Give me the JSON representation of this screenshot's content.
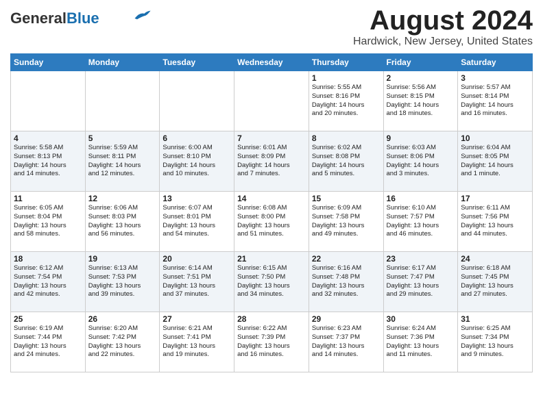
{
  "header": {
    "logo_general": "General",
    "logo_blue": "Blue",
    "month_title": "August 2024",
    "location": "Hardwick, New Jersey, United States"
  },
  "weekdays": [
    "Sunday",
    "Monday",
    "Tuesday",
    "Wednesday",
    "Thursday",
    "Friday",
    "Saturday"
  ],
  "weeks": [
    [
      {
        "day": "",
        "content": ""
      },
      {
        "day": "",
        "content": ""
      },
      {
        "day": "",
        "content": ""
      },
      {
        "day": "",
        "content": ""
      },
      {
        "day": "1",
        "content": "Sunrise: 5:55 AM\nSunset: 8:16 PM\nDaylight: 14 hours\nand 20 minutes."
      },
      {
        "day": "2",
        "content": "Sunrise: 5:56 AM\nSunset: 8:15 PM\nDaylight: 14 hours\nand 18 minutes."
      },
      {
        "day": "3",
        "content": "Sunrise: 5:57 AM\nSunset: 8:14 PM\nDaylight: 14 hours\nand 16 minutes."
      }
    ],
    [
      {
        "day": "4",
        "content": "Sunrise: 5:58 AM\nSunset: 8:13 PM\nDaylight: 14 hours\nand 14 minutes."
      },
      {
        "day": "5",
        "content": "Sunrise: 5:59 AM\nSunset: 8:11 PM\nDaylight: 14 hours\nand 12 minutes."
      },
      {
        "day": "6",
        "content": "Sunrise: 6:00 AM\nSunset: 8:10 PM\nDaylight: 14 hours\nand 10 minutes."
      },
      {
        "day": "7",
        "content": "Sunrise: 6:01 AM\nSunset: 8:09 PM\nDaylight: 14 hours\nand 7 minutes."
      },
      {
        "day": "8",
        "content": "Sunrise: 6:02 AM\nSunset: 8:08 PM\nDaylight: 14 hours\nand 5 minutes."
      },
      {
        "day": "9",
        "content": "Sunrise: 6:03 AM\nSunset: 8:06 PM\nDaylight: 14 hours\nand 3 minutes."
      },
      {
        "day": "10",
        "content": "Sunrise: 6:04 AM\nSunset: 8:05 PM\nDaylight: 14 hours\nand 1 minute."
      }
    ],
    [
      {
        "day": "11",
        "content": "Sunrise: 6:05 AM\nSunset: 8:04 PM\nDaylight: 13 hours\nand 58 minutes."
      },
      {
        "day": "12",
        "content": "Sunrise: 6:06 AM\nSunset: 8:03 PM\nDaylight: 13 hours\nand 56 minutes."
      },
      {
        "day": "13",
        "content": "Sunrise: 6:07 AM\nSunset: 8:01 PM\nDaylight: 13 hours\nand 54 minutes."
      },
      {
        "day": "14",
        "content": "Sunrise: 6:08 AM\nSunset: 8:00 PM\nDaylight: 13 hours\nand 51 minutes."
      },
      {
        "day": "15",
        "content": "Sunrise: 6:09 AM\nSunset: 7:58 PM\nDaylight: 13 hours\nand 49 minutes."
      },
      {
        "day": "16",
        "content": "Sunrise: 6:10 AM\nSunset: 7:57 PM\nDaylight: 13 hours\nand 46 minutes."
      },
      {
        "day": "17",
        "content": "Sunrise: 6:11 AM\nSunset: 7:56 PM\nDaylight: 13 hours\nand 44 minutes."
      }
    ],
    [
      {
        "day": "18",
        "content": "Sunrise: 6:12 AM\nSunset: 7:54 PM\nDaylight: 13 hours\nand 42 minutes."
      },
      {
        "day": "19",
        "content": "Sunrise: 6:13 AM\nSunset: 7:53 PM\nDaylight: 13 hours\nand 39 minutes."
      },
      {
        "day": "20",
        "content": "Sunrise: 6:14 AM\nSunset: 7:51 PM\nDaylight: 13 hours\nand 37 minutes."
      },
      {
        "day": "21",
        "content": "Sunrise: 6:15 AM\nSunset: 7:50 PM\nDaylight: 13 hours\nand 34 minutes."
      },
      {
        "day": "22",
        "content": "Sunrise: 6:16 AM\nSunset: 7:48 PM\nDaylight: 13 hours\nand 32 minutes."
      },
      {
        "day": "23",
        "content": "Sunrise: 6:17 AM\nSunset: 7:47 PM\nDaylight: 13 hours\nand 29 minutes."
      },
      {
        "day": "24",
        "content": "Sunrise: 6:18 AM\nSunset: 7:45 PM\nDaylight: 13 hours\nand 27 minutes."
      }
    ],
    [
      {
        "day": "25",
        "content": "Sunrise: 6:19 AM\nSunset: 7:44 PM\nDaylight: 13 hours\nand 24 minutes."
      },
      {
        "day": "26",
        "content": "Sunrise: 6:20 AM\nSunset: 7:42 PM\nDaylight: 13 hours\nand 22 minutes."
      },
      {
        "day": "27",
        "content": "Sunrise: 6:21 AM\nSunset: 7:41 PM\nDaylight: 13 hours\nand 19 minutes."
      },
      {
        "day": "28",
        "content": "Sunrise: 6:22 AM\nSunset: 7:39 PM\nDaylight: 13 hours\nand 16 minutes."
      },
      {
        "day": "29",
        "content": "Sunrise: 6:23 AM\nSunset: 7:37 PM\nDaylight: 13 hours\nand 14 minutes."
      },
      {
        "day": "30",
        "content": "Sunrise: 6:24 AM\nSunset: 7:36 PM\nDaylight: 13 hours\nand 11 minutes."
      },
      {
        "day": "31",
        "content": "Sunrise: 6:25 AM\nSunset: 7:34 PM\nDaylight: 13 hours\nand 9 minutes."
      }
    ]
  ]
}
